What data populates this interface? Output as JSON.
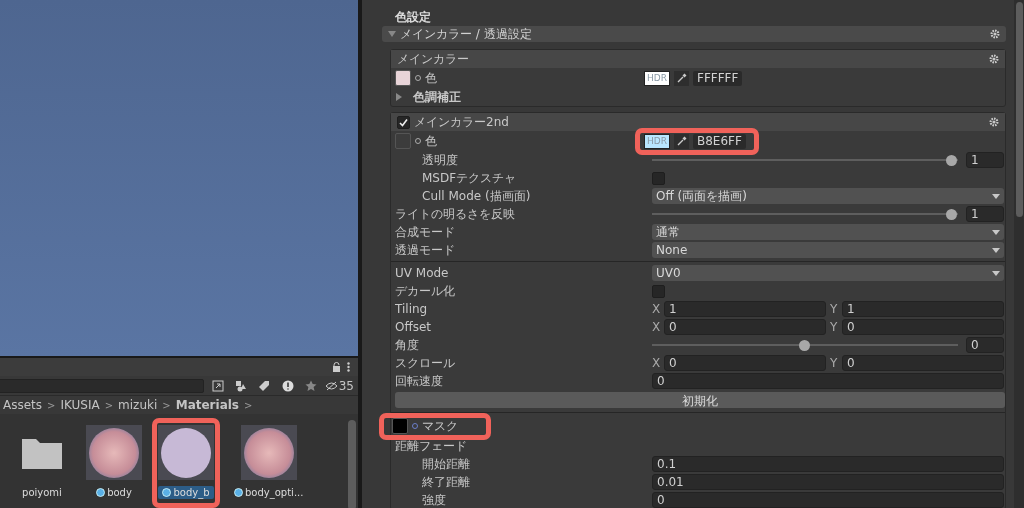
{
  "project": {
    "hidden_count": "35",
    "breadcrumb": [
      {
        "label": "Assets",
        "separator": ">"
      },
      {
        "label": "IKUSIA",
        "separator": ">"
      },
      {
        "label": "mizuki",
        "separator": ">"
      },
      {
        "label": "Materials",
        "separator": ">"
      }
    ],
    "assets": [
      {
        "name": "poiyomi",
        "kind": "folder",
        "selected": false,
        "highlighted": false
      },
      {
        "name": "body",
        "kind": "material",
        "selected": false,
        "highlighted": false
      },
      {
        "name": "body_b",
        "kind": "material",
        "selected": true,
        "highlighted": true
      },
      {
        "name": "body_opti...",
        "kind": "material",
        "selected": false,
        "highlighted": false
      }
    ]
  },
  "inspector": {
    "section_title": "色設定",
    "foldout": {
      "title": "メインカラー / 透過設定",
      "expanded": true
    },
    "boxes": [
      {
        "title": "メインカラー",
        "rows": [
          {
            "kind": "color",
            "label": "色",
            "color": "#e8d4d8",
            "hdr": "HDR",
            "hex": "FFFFFF",
            "highlighted": false
          },
          {
            "kind": "fold",
            "label": "色調補正",
            "expanded": false
          }
        ]
      },
      {
        "title": "メインカラー2nd",
        "checked": true,
        "rows": [
          {
            "kind": "color",
            "label": "色",
            "color": "#3c3c3c",
            "hdr": "HDR",
            "hex": "B8E6FF",
            "highlighted": true,
            "children": [
              {
                "kind": "slider",
                "label": "透明度",
                "level": 1,
                "value": "1"
              },
              {
                "kind": "checkbox",
                "label": "MSDFテクスチャ",
                "checked": false
              },
              {
                "kind": "dropdown",
                "label": "Cull Mode (描画面)",
                "value": "Off (両面を描画)"
              }
            ]
          },
          {
            "kind": "slider",
            "label": "ライトの明るさを反映",
            "level": 1,
            "value": "1"
          },
          {
            "kind": "dropdown",
            "label": "合成モード",
            "value": "通常"
          },
          {
            "kind": "dropdown",
            "label": "透過モード",
            "value": "None"
          },
          {
            "kind": "divider"
          },
          {
            "kind": "dropdown",
            "label": "UV Mode",
            "value": "UV0"
          },
          {
            "kind": "checkbox",
            "label": "デカール化",
            "checked": false
          },
          {
            "kind": "vector",
            "label": "Tiling",
            "fields": [
              {
                "axis": "X",
                "value": "1"
              },
              {
                "axis": "Y",
                "value": "1"
              }
            ]
          },
          {
            "kind": "vector",
            "label": "Offset",
            "fields": [
              {
                "axis": "X",
                "value": "0"
              },
              {
                "axis": "Y",
                "value": "0"
              }
            ]
          },
          {
            "kind": "slider",
            "label": "角度",
            "level": 0.5,
            "value": "0"
          },
          {
            "kind": "vector",
            "label": "スクロール",
            "fields": [
              {
                "axis": "X",
                "value": "0"
              },
              {
                "axis": "Y",
                "value": "0"
              }
            ]
          },
          {
            "kind": "number",
            "label": "回転速度",
            "value": "0"
          },
          {
            "kind": "button",
            "label": "初期化"
          },
          {
            "kind": "divider"
          },
          {
            "kind": "texture",
            "label": "マスク",
            "color": "#000000",
            "highlighted": true
          },
          {
            "kind": "group",
            "label": "距離フェード",
            "children": [
              {
                "kind": "number",
                "label": "開始距離",
                "value": "0.1"
              },
              {
                "kind": "number",
                "label": "終了距離",
                "value": "0.01"
              },
              {
                "kind": "number",
                "label": "強度",
                "value": "0"
              }
            ]
          }
        ]
      }
    ]
  }
}
